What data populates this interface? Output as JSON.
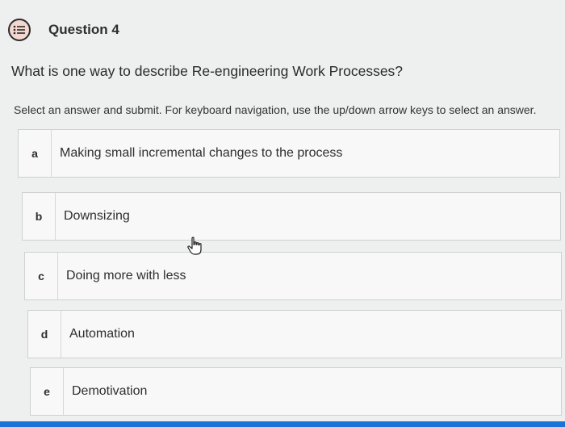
{
  "header": {
    "title": "Question 4",
    "icon": "question-list-icon"
  },
  "question": {
    "text": "What is one way to describe Re-engineering Work Processes?"
  },
  "instructions": {
    "text": "Select an answer and submit. For keyboard navigation, use the up/down arrow keys to select an answer."
  },
  "options": [
    {
      "letter": "a",
      "text": "Making small incremental changes to the process"
    },
    {
      "letter": "b",
      "text": "Downsizing"
    },
    {
      "letter": "c",
      "text": "Doing more with less"
    },
    {
      "letter": "d",
      "text": "Automation"
    },
    {
      "letter": "e",
      "text": "Demotivation"
    }
  ],
  "colors": {
    "accent": "#1a73d9",
    "icon_bg": "#f4d7cf",
    "background": "#eef0ef"
  }
}
